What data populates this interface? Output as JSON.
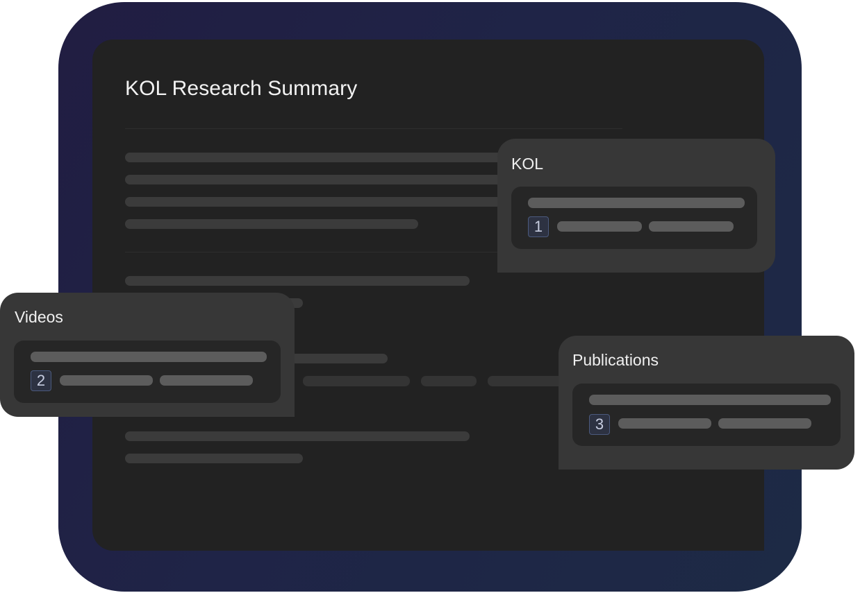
{
  "document": {
    "title": "KOL Research Summary"
  },
  "sources": {
    "kol": {
      "label": "KOL",
      "citation": "1"
    },
    "videos": {
      "label": "Videos",
      "citation": "2"
    },
    "publications": {
      "label": "Publications",
      "citation": "3"
    }
  },
  "colors": {
    "frame_gradient_start": "#211d42",
    "frame_gradient_end": "#1d2a45",
    "document_background": "#222222",
    "card_background": "#373737",
    "citation_badge_border": "#4b5a7e"
  }
}
